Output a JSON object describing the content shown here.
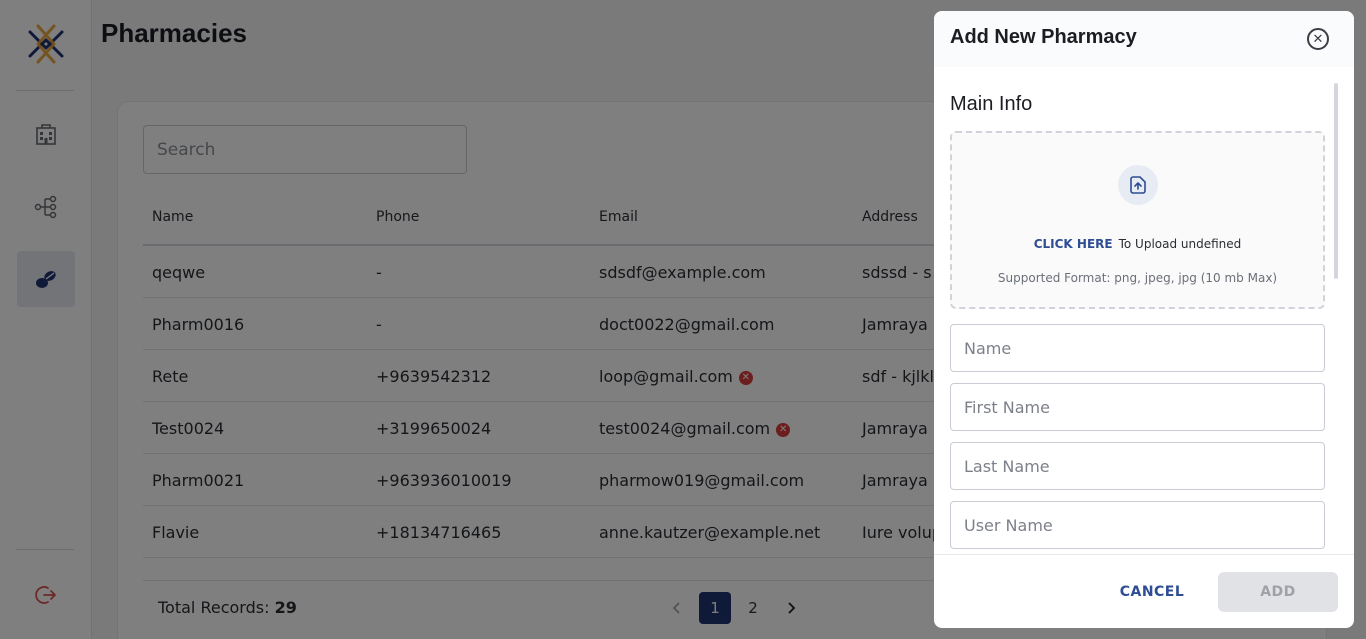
{
  "page": {
    "title": "Pharmacies"
  },
  "search": {
    "placeholder": "Search"
  },
  "table": {
    "headers": [
      "Name",
      "Phone",
      "Email",
      "Address"
    ],
    "rows": [
      {
        "name": "qeqwe",
        "phone": "-",
        "email": "sdsdf@example.com",
        "address": "sdssd - s",
        "email_error": false
      },
      {
        "name": "Pharm0016",
        "phone": "-",
        "email": "doct0022@gmail.com",
        "address": "Jamraya",
        "email_error": false
      },
      {
        "name": "Rete",
        "phone": "+9639542312",
        "email": "loop@gmail.com",
        "address": "sdf - kjlkl",
        "email_error": true
      },
      {
        "name": "Test0024",
        "phone": "+3199650024",
        "email": "test0024@gmail.com",
        "address": "Jamraya",
        "email_error": true
      },
      {
        "name": "Pharm0021",
        "phone": "+963936010019",
        "email": "pharmow019@gmail.com",
        "address": "Jamraya",
        "email_error": false
      },
      {
        "name": "Flavie",
        "phone": "+18134716465",
        "email": "anne.kautzer@example.net",
        "address": "Iure volup",
        "email_error": false
      }
    ]
  },
  "footer": {
    "total_label": "Total Records:",
    "total_value": "29"
  },
  "pagination": {
    "pages": [
      "1",
      "2"
    ],
    "current": "1"
  },
  "sidebar": {
    "items": [
      "hospital-icon",
      "hierarchy-icon",
      "pills-icon"
    ],
    "logout": "logout-icon"
  },
  "modal": {
    "title": "Add New Pharmacy",
    "section": "Main Info",
    "upload": {
      "link": "CLICK HERE",
      "text": "To Upload undefined",
      "formats": "Supported Format: png, jpeg, jpg (10 mb Max)"
    },
    "fields": {
      "name": "Name",
      "first_name": "First Name",
      "last_name": "Last Name",
      "user_name": "User Name"
    },
    "cancel": "CANCEL",
    "add": "ADD"
  },
  "colors": {
    "accent": "#1e3270",
    "link": "#2e4d93",
    "error": "#d93b3b",
    "logo_orange": "#e8a030"
  }
}
